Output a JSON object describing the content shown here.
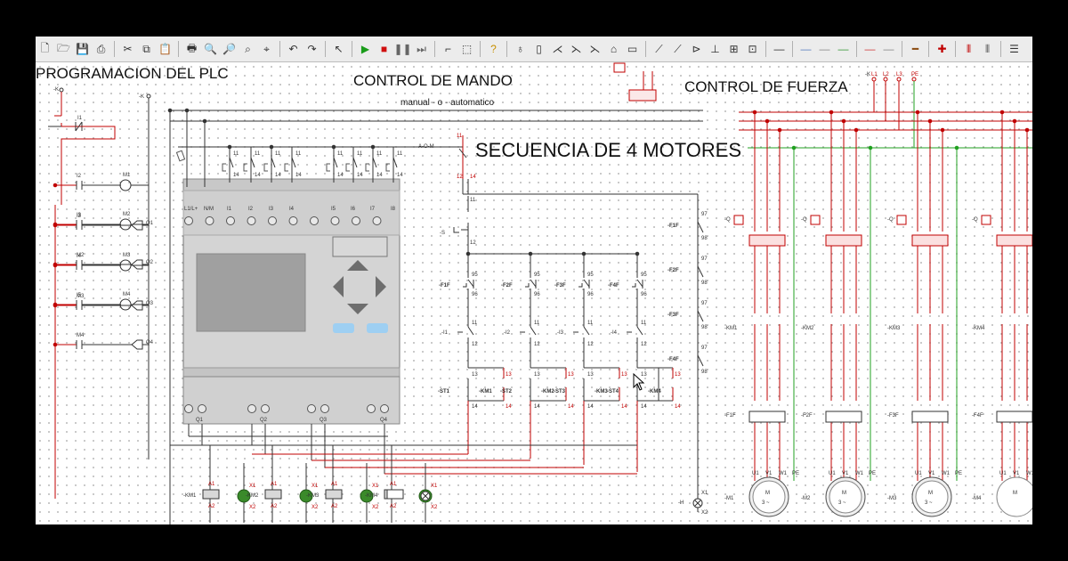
{
  "toolbar": {
    "icons": [
      {
        "name": "new-file-icon",
        "glyph": "🗋"
      },
      {
        "name": "open-folder-icon",
        "glyph": "🗁"
      },
      {
        "name": "save-icon",
        "glyph": "💾"
      },
      {
        "name": "print-icon",
        "glyph": "⎙"
      },
      {
        "sep": true
      },
      {
        "name": "cut-icon",
        "glyph": "✂"
      },
      {
        "name": "copy-icon",
        "glyph": "⧉"
      },
      {
        "name": "paste-icon",
        "glyph": "📋"
      },
      {
        "sep": true
      },
      {
        "name": "print-preview-icon",
        "glyph": "🖶"
      },
      {
        "name": "zoom-in-icon",
        "glyph": "🔍"
      },
      {
        "name": "zoom-out-icon",
        "glyph": "🔎"
      },
      {
        "name": "zoom-fit-icon",
        "glyph": "⌕"
      },
      {
        "name": "zoom-window-icon",
        "glyph": "⌖"
      },
      {
        "sep": true
      },
      {
        "name": "undo-icon",
        "glyph": "↶"
      },
      {
        "name": "redo-icon",
        "glyph": "↷"
      },
      {
        "sep": true
      },
      {
        "name": "pointer-icon",
        "glyph": "↖"
      },
      {
        "sep": true
      },
      {
        "name": "play-icon",
        "glyph": "▶",
        "color": "#1a9c1a"
      },
      {
        "name": "stop-icon",
        "glyph": "■",
        "color": "#d01010"
      },
      {
        "name": "pause-icon",
        "glyph": "❚❚",
        "color": "#666"
      },
      {
        "name": "step-icon",
        "glyph": "⏭",
        "color": "#666"
      },
      {
        "sep": true
      },
      {
        "name": "wire-icon",
        "glyph": "⌐"
      },
      {
        "name": "select-area-icon",
        "glyph": "⬚"
      },
      {
        "sep": true
      },
      {
        "name": "help-icon",
        "glyph": "?",
        "color": "#c89000"
      },
      {
        "sep": true
      },
      {
        "name": "lamp-tool-icon",
        "glyph": "♁"
      },
      {
        "name": "fuse-tool-icon",
        "glyph": "▯"
      },
      {
        "name": "switch-tool-icon",
        "glyph": "⋌"
      },
      {
        "name": "contact-nc-tool-icon",
        "glyph": "⋋"
      },
      {
        "name": "contact-nc2-tool-icon",
        "glyph": "⋋"
      },
      {
        "name": "coil-tool-icon",
        "glyph": "⌂"
      },
      {
        "name": "relay-tool-icon",
        "glyph": "▭"
      },
      {
        "sep": true
      },
      {
        "name": "contact-no-tool-icon",
        "glyph": "⟋"
      },
      {
        "name": "contact-tool-icon",
        "glyph": "⟋"
      },
      {
        "name": "diode-tool-icon",
        "glyph": "⊳"
      },
      {
        "name": "junction-tool-icon",
        "glyph": "⊥"
      },
      {
        "name": "resistor-tool-icon",
        "glyph": "⊞"
      },
      {
        "name": "timer-tool-icon",
        "glyph": "⊡"
      },
      {
        "sep": true
      },
      {
        "name": "wire-gray-icon",
        "glyph": "—"
      },
      {
        "sep": true
      },
      {
        "name": "wire-blue-icon",
        "glyph": "—",
        "color": "#5a7fc0"
      },
      {
        "name": "wire-gray2-icon",
        "glyph": "—",
        "color": "#888"
      },
      {
        "name": "wire-green-icon",
        "glyph": "—",
        "color": "#3a9a3a"
      },
      {
        "sep": true
      },
      {
        "name": "wire-red-icon",
        "glyph": "—",
        "color": "#d04040"
      },
      {
        "name": "wire-gray3-icon",
        "glyph": "—",
        "color": "#888"
      },
      {
        "sep": true
      },
      {
        "name": "wire-brown-icon",
        "glyph": "━",
        "color": "#8a4a10"
      },
      {
        "sep": true
      },
      {
        "name": "node-icon",
        "glyph": "✚",
        "color": "#c00000"
      },
      {
        "sep": true
      },
      {
        "name": "three-phase-icon",
        "glyph": "⫴",
        "color": "#c00000"
      },
      {
        "name": "two-phase-icon",
        "glyph": "⫴",
        "color": "#555"
      },
      {
        "sep": true
      },
      {
        "name": "menu-icon",
        "glyph": "☰"
      }
    ]
  },
  "titles": {
    "plc": "PROGRAMACION DEL PLC",
    "mando": "CONTROL DE MANDO",
    "fuerza": "CONTROL DE FUERZA",
    "secuencia": "SECUENCIA DE 4 MOTORES",
    "auto": "manual - o - automatico"
  },
  "ladder": {
    "k_minus": "-K",
    "contacts": [
      "I1",
      "I2",
      "I3",
      "M2",
      "I4",
      "M3",
      "I5",
      "M4",
      "I6",
      "M4"
    ],
    "coils": [
      "M1",
      "Q1",
      "M2",
      "Q2",
      "M3",
      "Q3",
      "M4",
      "Q4"
    ]
  },
  "plc": {
    "top_labels": [
      "L1/L+",
      "N/M",
      "I1",
      "I2",
      "I3",
      "I4",
      "I5",
      "I6",
      "I7",
      "I8"
    ],
    "bottom_labels": [
      "Q1",
      "Q2",
      "Q3",
      "Q4"
    ]
  },
  "mando": {
    "start_label": "A-O-M",
    "stop_label": "-S",
    "overloads": [
      "-F1F",
      "-F2F",
      "-F3F",
      "-F4F"
    ],
    "inputs": [
      "-I1",
      "-I2",
      "-I3",
      "-I4"
    ],
    "timers": [
      "-ST1",
      "-ST2",
      "-ST3",
      "-ST4"
    ],
    "km": [
      "-KM1",
      "-KM2",
      "-KM3",
      "-KM4"
    ],
    "lamp_label": "-H",
    "pins": {
      "a": "11",
      "b": "12",
      "c": "13",
      "d": "14",
      "e": "95",
      "f": "96",
      "g": "97",
      "h": "98",
      "x1": "X1",
      "x2": "X2",
      "a1": "A1",
      "a2": "A2"
    }
  },
  "fuerza": {
    "phases": [
      "L1",
      "L2",
      "L3",
      "PE"
    ],
    "q_labels": [
      "-Q",
      "-Q",
      "-Q",
      "-Q"
    ],
    "km_labels": [
      "-KM1",
      "-KM2",
      "-KM3",
      "-KM4"
    ],
    "f_labels": [
      "-F1F",
      "-F2F",
      "-F3F",
      "-F4F"
    ],
    "motor_labels": [
      "-M1",
      "-M2",
      "-M3",
      "-M4"
    ],
    "terminals": [
      "U1",
      "V1",
      "W1",
      "PE"
    ],
    "motor_text": "M",
    "motor_phase": "3 ~"
  },
  "colors": {
    "accent": "#c00000",
    "ground": "#20a020",
    "wire": "#333333",
    "plc_body": "#d4d4d4",
    "screen": "#9c9c9c",
    "lamp": "#3a8a2a"
  }
}
